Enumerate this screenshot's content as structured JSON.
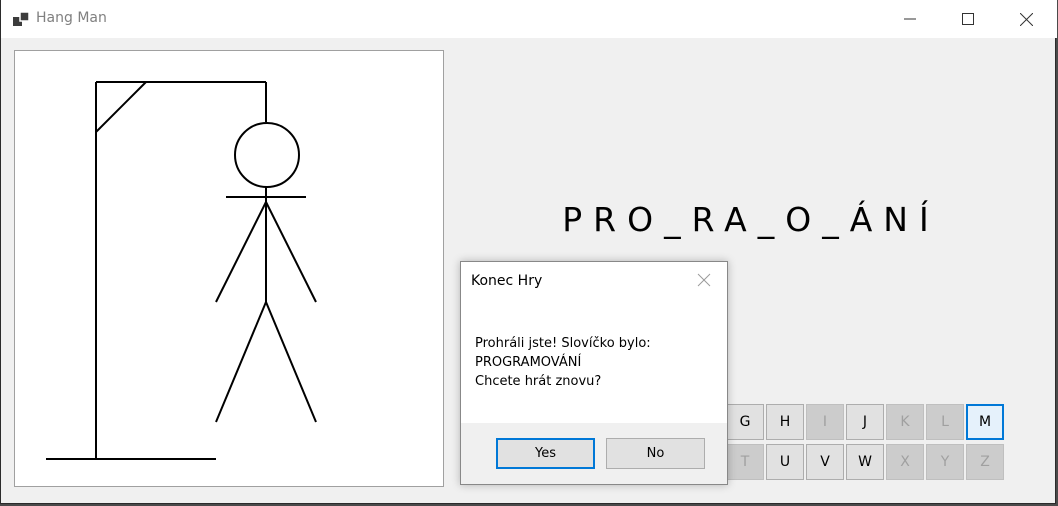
{
  "window": {
    "title": "Hang Man",
    "minimize_icon": "minimize-icon",
    "maximize_icon": "maximize-icon",
    "close_icon": "close-icon"
  },
  "game": {
    "word_mask": "PRO_RA_O_ÁNÍ",
    "keyboard": [
      {
        "letter": "G",
        "state": "enabled"
      },
      {
        "letter": "H",
        "state": "enabled"
      },
      {
        "letter": "I",
        "state": "disabled"
      },
      {
        "letter": "J",
        "state": "enabled"
      },
      {
        "letter": "K",
        "state": "disabled"
      },
      {
        "letter": "L",
        "state": "disabled"
      },
      {
        "letter": "M",
        "state": "focused"
      },
      {
        "letter": "T",
        "state": "disabled"
      },
      {
        "letter": "U",
        "state": "enabled"
      },
      {
        "letter": "V",
        "state": "enabled"
      },
      {
        "letter": "W",
        "state": "enabled"
      },
      {
        "letter": "X",
        "state": "disabled"
      },
      {
        "letter": "Y",
        "state": "disabled"
      },
      {
        "letter": "Z",
        "state": "disabled"
      }
    ]
  },
  "dialog": {
    "title": "Konec Hry",
    "message_line1": "Prohráli jste! Slovíčko bylo:",
    "message_line2": "PROGRAMOVÁNÍ",
    "message_line3": "Chcete hrát znovu?",
    "yes_label": "Yes",
    "no_label": "No"
  },
  "colors": {
    "accent": "#0078d7",
    "window_bg": "#f0f0f0"
  }
}
